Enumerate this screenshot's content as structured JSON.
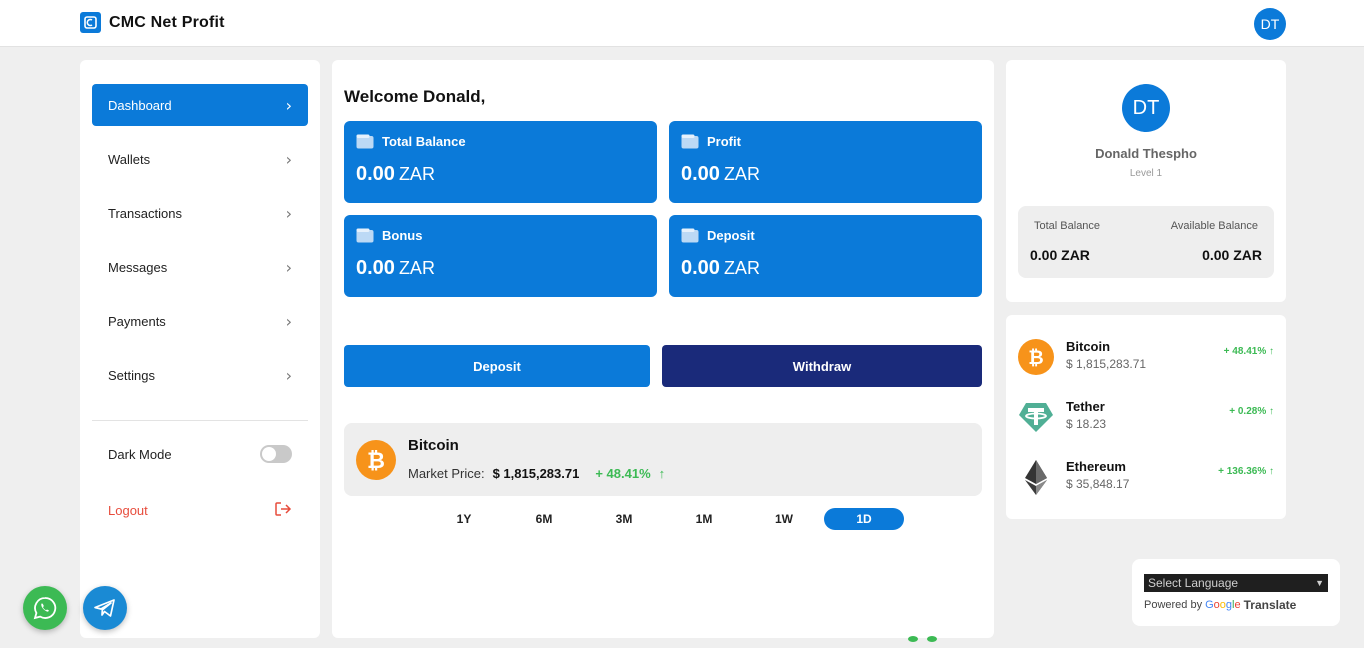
{
  "brand": {
    "title": "CMC Net Profit",
    "avatar_initials": "DT"
  },
  "sidebar": {
    "items": [
      {
        "label": "Dashboard",
        "active": true
      },
      {
        "label": "Wallets",
        "active": false
      },
      {
        "label": "Transactions",
        "active": false
      },
      {
        "label": "Messages",
        "active": false
      },
      {
        "label": "Payments",
        "active": false
      },
      {
        "label": "Settings",
        "active": false
      }
    ],
    "dark_mode_label": "Dark Mode",
    "dark_mode_on": false,
    "logout_label": "Logout"
  },
  "main": {
    "welcome": "Welcome Donald,",
    "cards": [
      {
        "label": "Total Balance",
        "value": "0.00",
        "currency": "ZAR"
      },
      {
        "label": "Profit",
        "value": "0.00",
        "currency": "ZAR"
      },
      {
        "label": "Bonus",
        "value": "0.00",
        "currency": "ZAR"
      },
      {
        "label": "Deposit",
        "value": "0.00",
        "currency": "ZAR"
      }
    ],
    "deposit_button": "Deposit",
    "withdraw_button": "Withdraw",
    "coin": {
      "name": "Bitcoin",
      "market_label": "Market Price:",
      "price": "$ 1,815,283.71",
      "change": "+ 48.41%"
    },
    "periods": [
      "1Y",
      "6M",
      "3M",
      "1M",
      "1W",
      "1D"
    ],
    "active_period": "1D"
  },
  "profile": {
    "initials": "DT",
    "name": "Donald Thespho",
    "level": "Level 1",
    "total_balance_label": "Total Balance",
    "total_balance_value": "0.00 ZAR",
    "available_balance_label": "Available Balance",
    "available_balance_value": "0.00 ZAR"
  },
  "coins": [
    {
      "name": "Bitcoin",
      "price": "$ 1,815,283.71",
      "change": "+ 48.41%",
      "icon": "bitcoin-icon"
    },
    {
      "name": "Tether",
      "price": "$ 18.23",
      "change": "+ 0.28%",
      "icon": "tether-icon"
    },
    {
      "name": "Ethereum",
      "price": "$ 35,848.17",
      "change": "+ 136.36%",
      "icon": "ethereum-icon"
    }
  ],
  "translate": {
    "select_label": "Select Language",
    "powered_by": "Powered by",
    "google": "Google",
    "translate": "Translate"
  },
  "colors": {
    "accent": "#0b7ad9",
    "withdraw": "#1a2a7a",
    "positive": "#3cba54",
    "logout": "#e74c3c"
  }
}
